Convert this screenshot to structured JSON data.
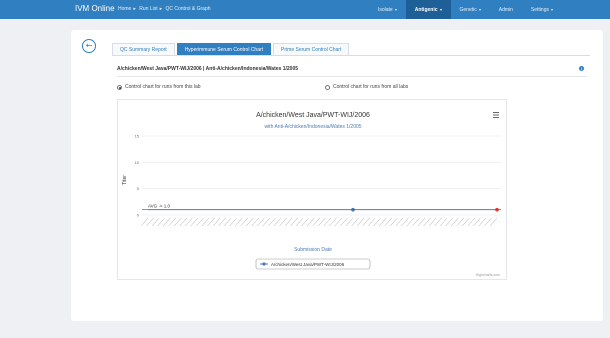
{
  "navbar": {
    "brand": "IVM Online",
    "breadcrumb": [
      "Home",
      "Run List",
      "QC Control & Graph"
    ],
    "items": [
      {
        "label": "Isolate",
        "active": false
      },
      {
        "label": "Antigenic",
        "active": true
      },
      {
        "label": "Genetic",
        "active": false
      },
      {
        "label": "Admin",
        "active": false
      },
      {
        "label": "Settings",
        "active": false
      }
    ]
  },
  "tabs": [
    {
      "label": "QC Summary Report",
      "active": false
    },
    {
      "label": "Hyperimmune Serum Control Chart",
      "active": true
    },
    {
      "label": "Prime Serum Control Chart",
      "active": false
    }
  ],
  "panel": {
    "title": "A/chicken/West Java/PWT-WIJ/2006 | Anti-A/chicken/Indonesia/Wates 1/2005",
    "info_icon": "info-icon"
  },
  "radios": [
    {
      "label": "Control chart for runs from this lab",
      "checked": true
    },
    {
      "label": "Control chart for runs from all labs",
      "checked": false
    }
  ],
  "colors": {
    "navbar": "#2f7fc1",
    "navbar_active": "#1f5f97",
    "accent": "#2f7fc1",
    "series": "#4a7ab5",
    "outlier": "#e53935"
  },
  "chart_data": {
    "type": "line",
    "title": "A/chicken/West Java/PWT-WIJ/2006",
    "subtitle": "with Anti-A/chicken/Indonesia/Wates 1/2005",
    "xlabel": "Submission Date",
    "ylabel": "Titer",
    "yticks": [
      "0",
      "5",
      "10",
      "15"
    ],
    "ylim": [
      0,
      15
    ],
    "avg_label": "AVG -> 1.0",
    "avg_value": 1,
    "grid": true,
    "legend_position": "bottom",
    "credit": "Highcharts.com",
    "menu_icon": "hamburger-menu-icon",
    "x_count": 64,
    "series": [
      {
        "name": "A/chicken/West Java/PWT-WIJ/2006",
        "values": [
          1,
          1,
          1,
          1,
          1,
          1,
          1,
          1,
          1,
          1,
          1,
          1,
          1,
          1,
          1,
          1,
          1,
          1,
          1,
          1,
          1,
          1,
          1,
          1,
          1,
          1,
          1,
          1,
          1,
          1,
          1,
          1,
          1,
          1,
          1,
          1,
          1,
          1,
          1,
          1,
          1,
          1,
          1,
          1,
          1,
          1,
          1,
          1,
          1,
          1,
          1,
          1,
          1,
          1,
          1,
          1,
          1,
          1,
          1,
          1,
          1,
          1,
          1,
          1
        ]
      }
    ],
    "highlight_points": [
      {
        "index": 37,
        "value": 1,
        "kind": "marker"
      },
      {
        "index": 63,
        "value": 1,
        "kind": "outlier"
      }
    ]
  }
}
